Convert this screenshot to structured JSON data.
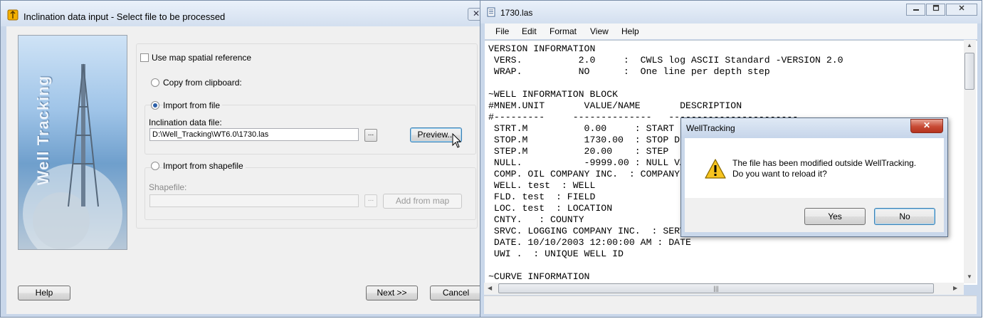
{
  "wizard": {
    "title": "Inclination data input - Select file to be processed",
    "close_glyph": "✕",
    "banner_text": "Well Tracking",
    "use_map_spatial_reference": {
      "label": "Use map spatial reference",
      "checked": false
    },
    "copy_from_clipboard": {
      "label": "Copy from clipboard:",
      "selected": false
    },
    "import_from_file": {
      "label": "Import from file",
      "selected": true,
      "field_label": "Inclination data file:",
      "field_value": "D:\\Well_Tracking\\WT6.0\\1730.las",
      "browse_label": "...",
      "preview_label": "Preview..."
    },
    "import_from_shapefile": {
      "label": "Import from shapefile",
      "selected": false,
      "field_label": "Shapefile:",
      "field_value": "",
      "browse_label": "...",
      "add_from_map_label": "Add from map"
    },
    "help_label": "Help",
    "next_label": "Next >>",
    "cancel_label": "Cancel"
  },
  "notepad": {
    "title": "1730.las",
    "menu": [
      "File",
      "Edit",
      "Format",
      "View",
      "Help"
    ],
    "lines": [
      "VERSION INFORMATION",
      " VERS.          2.0     :  CWLS log ASCII Standard -VERSION 2.0",
      " WRAP.          NO      :  One line per depth step",
      "",
      "~WELL INFORMATION BLOCK",
      "#MNEM.UNIT       VALUE/NAME       DESCRIPTION",
      "#---------     --------------   -----------------------",
      " STRT.M          0.00     : START DEPTH",
      " STOP.M          1730.00  : STOP DEPTH",
      " STEP.M          20.00    : STEP",
      " NULL.           -9999.00 : NULL VALUE",
      " COMP. OIL COMPANY INC.  : COMPANY",
      " WELL. test  : WELL",
      " FLD. test  : FIELD",
      " LOC. test  : LOCATION",
      " CNTY.   : COUNTY",
      " SRVC. LOGGING COMPANY INC.  : SERVICE COMPANY",
      " DATE. 10/10/2003 12:00:00 AM : DATE",
      " UWI .  : UNIQUE WELL ID",
      "",
      "~CURVE INFORMATION"
    ]
  },
  "message_box": {
    "title": "WellTracking",
    "close_glyph": "✕",
    "line1": "The file has been modified outside WellTracking.",
    "line2": "Do you want to reload it?",
    "yes_label": "Yes",
    "no_label": "No"
  }
}
